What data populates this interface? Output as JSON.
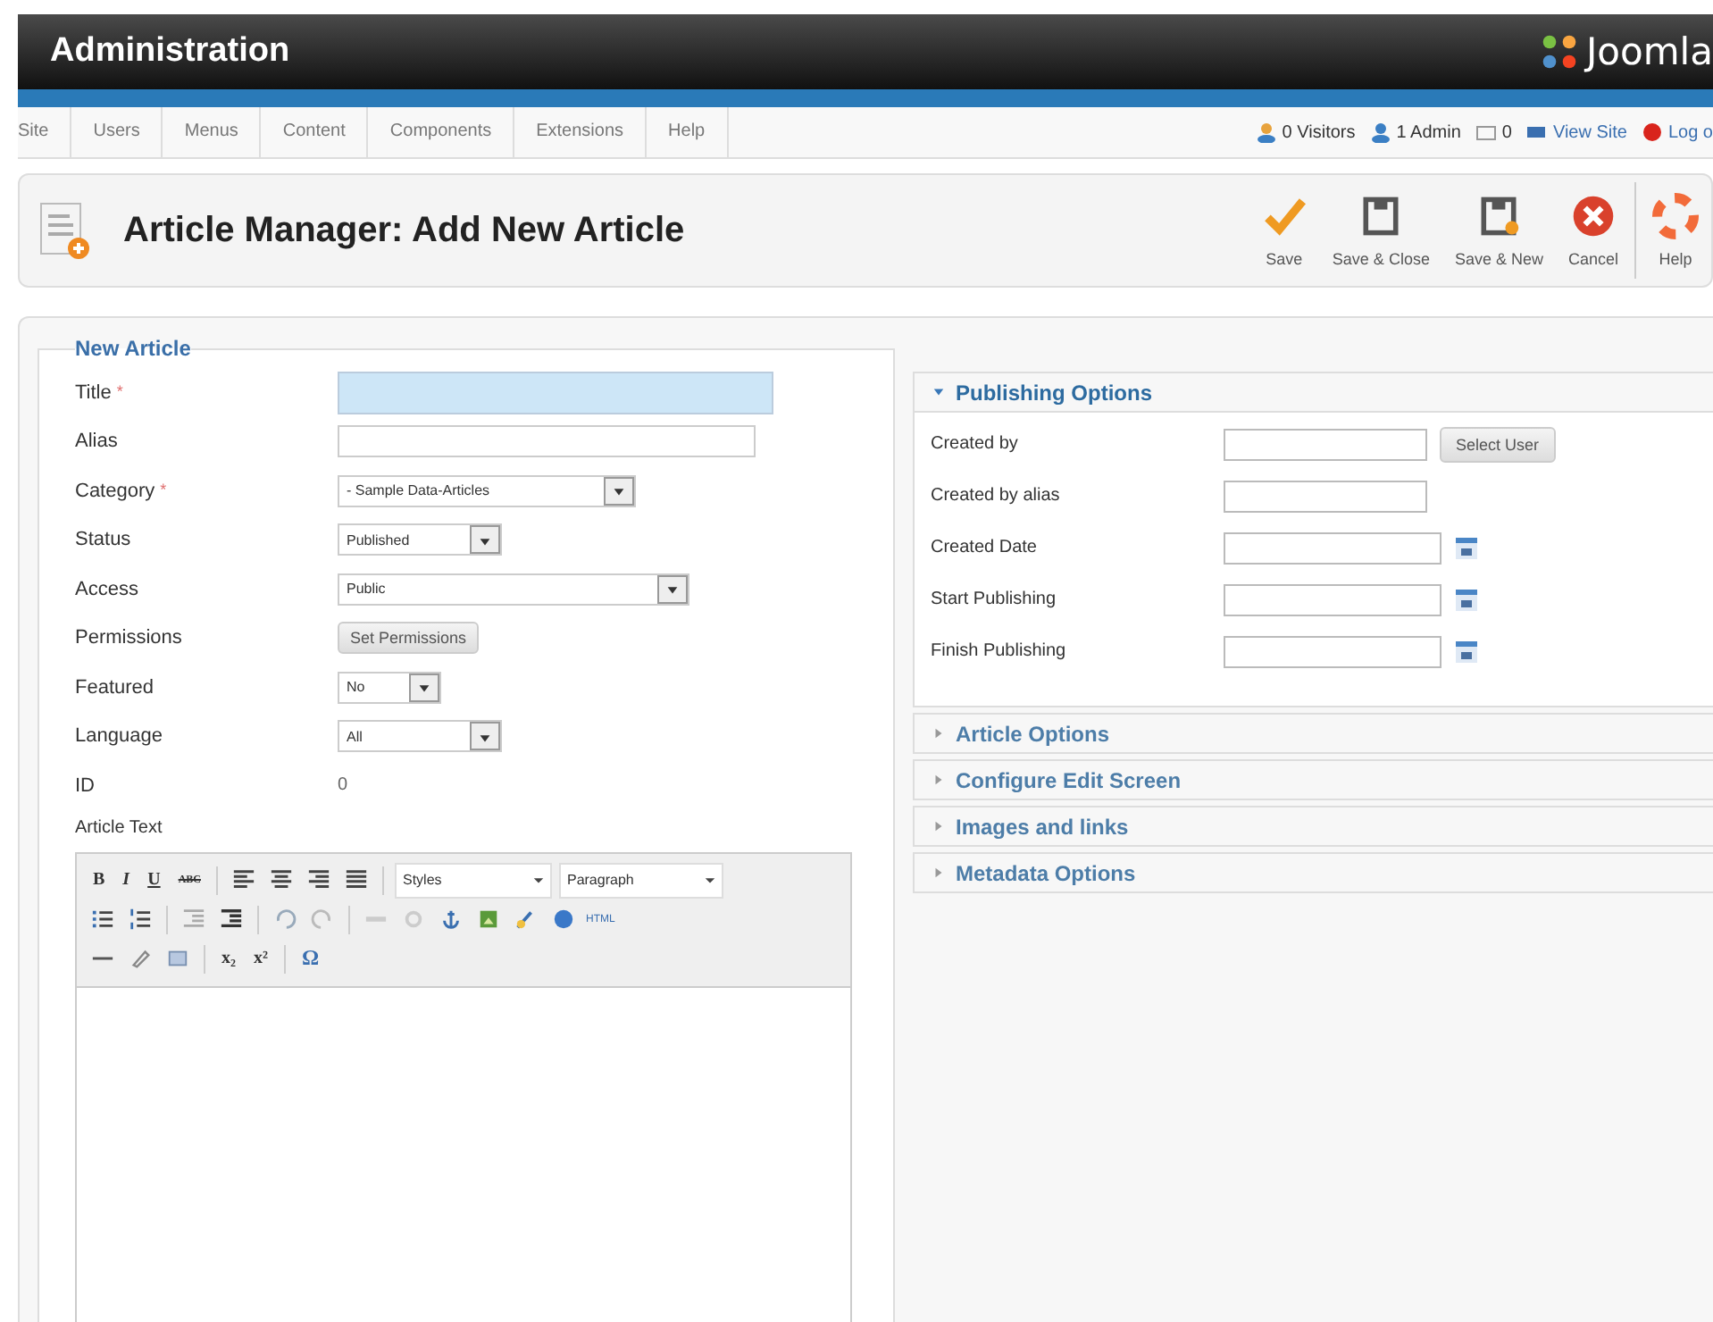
{
  "header": {
    "title": "Administration",
    "logo": "Joomla"
  },
  "menu": [
    {
      "label": "Site"
    },
    {
      "label": "Users"
    },
    {
      "label": "Menus"
    },
    {
      "label": "Content"
    },
    {
      "label": "Components"
    },
    {
      "label": "Extensions"
    },
    {
      "label": "Help"
    }
  ],
  "status": [
    {
      "kind": "visitors",
      "label": "0 Visitors"
    },
    {
      "kind": "admin",
      "label": "1 Admin"
    },
    {
      "kind": "mail",
      "label": "0"
    },
    {
      "kind": "site",
      "label": "View Site"
    },
    {
      "kind": "logout",
      "label": "Log o"
    }
  ],
  "page_title": "Article Manager: Add New Article",
  "toolbar": [
    {
      "kind": "save",
      "label": "Save"
    },
    {
      "kind": "save-close",
      "label": "Save & Close"
    },
    {
      "kind": "save-new",
      "label": "Save & New"
    },
    {
      "kind": "cancel",
      "label": "Cancel"
    },
    {
      "kind": "help",
      "label": "Help"
    }
  ],
  "form": {
    "legend": "New Article",
    "required_mark": "*",
    "fields": [
      {
        "label": "Title",
        "required": true,
        "kind": "text",
        "focused": true
      },
      {
        "label": "Alias",
        "required": false,
        "kind": "text",
        "focused": false
      },
      {
        "label": "Category",
        "required": true,
        "kind": "select",
        "value": "- Sample Data-Articles"
      },
      {
        "label": "Status",
        "required": false,
        "kind": "select",
        "value": "Published"
      },
      {
        "label": "Access",
        "required": false,
        "kind": "select",
        "value": "Public"
      },
      {
        "label": "Permissions",
        "required": false,
        "kind": "button",
        "value": "Set Permissions"
      },
      {
        "label": "Featured",
        "required": false,
        "kind": "select",
        "value": "No"
      },
      {
        "label": "Language",
        "required": false,
        "kind": "select",
        "value": "All"
      },
      {
        "label": "ID",
        "required": false,
        "kind": "value",
        "value": "0"
      }
    ],
    "editor_label": "Article Text",
    "editor": {
      "bold": "B",
      "italic": "I",
      "underline": "U",
      "strike": "ABC",
      "styles": "Styles",
      "format": "Paragraph",
      "html": "HTML",
      "sub": "x₂",
      "sup": "x²",
      "omega": "Ω"
    }
  },
  "panels": [
    {
      "title": "Publishing Options",
      "expanded": true,
      "fields": [
        {
          "label": "Created by",
          "kind": "user",
          "button": "Select User"
        },
        {
          "label": "Created by alias",
          "kind": "text"
        },
        {
          "label": "Created Date",
          "kind": "date"
        },
        {
          "label": "Start Publishing",
          "kind": "date"
        },
        {
          "label": "Finish Publishing",
          "kind": "date"
        }
      ]
    },
    {
      "title": "Article Options",
      "expanded": false
    },
    {
      "title": "Configure Edit Screen",
      "expanded": false
    },
    {
      "title": "Images and links",
      "expanded": false
    },
    {
      "title": "Metadata Options",
      "expanded": false
    }
  ]
}
